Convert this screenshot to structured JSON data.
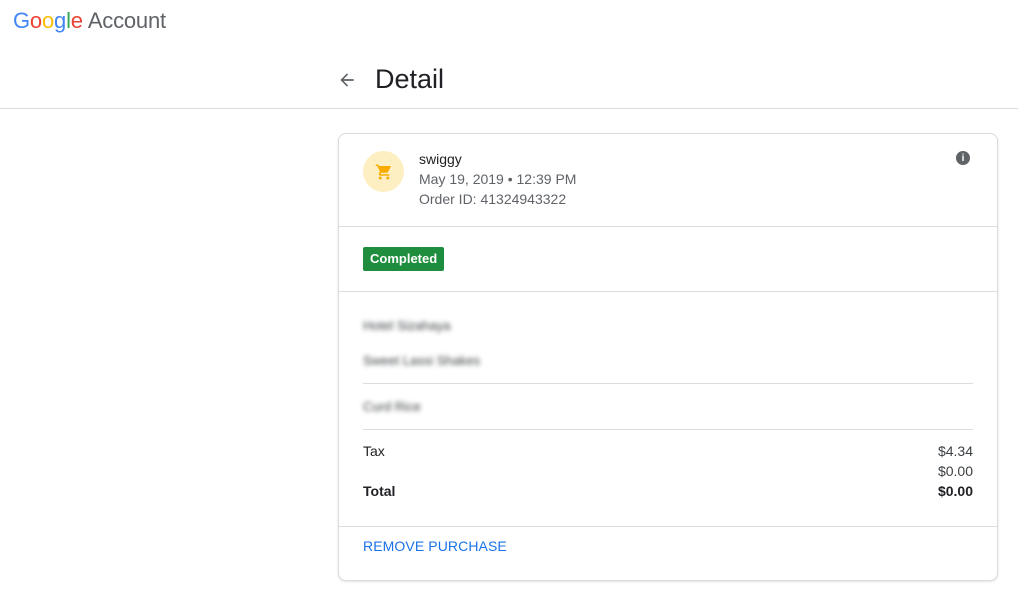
{
  "header": {
    "logo_letters": [
      "G",
      "o",
      "o",
      "g",
      "l",
      "e"
    ],
    "logo_suffix": "Account"
  },
  "page": {
    "back_icon": "arrow-left-icon",
    "title": "Detail"
  },
  "purchase": {
    "merchant_icon": "shopping-cart-icon",
    "merchant": "swiggy",
    "date_time": "May 19, 2019 • 12:39 PM",
    "order_id": "Order ID: 41324943322",
    "info_icon": "info-icon",
    "status": "Completed",
    "blurred_items": [
      "Hotel Sizahaya",
      "Sweet Lassi Shakes",
      "Curd Rice"
    ],
    "tax_label": "Tax",
    "tax_value": "$4.34",
    "extra_value": "$0.00",
    "total_label": "Total",
    "total_value": "$0.00",
    "remove_label": "REMOVE PURCHASE"
  },
  "colors": {
    "brand_blue": "#4285F4",
    "brand_red": "#EA4335",
    "brand_yellow": "#FBBC05",
    "brand_green": "#34A853",
    "status_green": "#1e8e3e",
    "link_blue": "#1a73e8",
    "avatar_bg": "#feefc3",
    "cart_icon": "#f9ab00"
  }
}
